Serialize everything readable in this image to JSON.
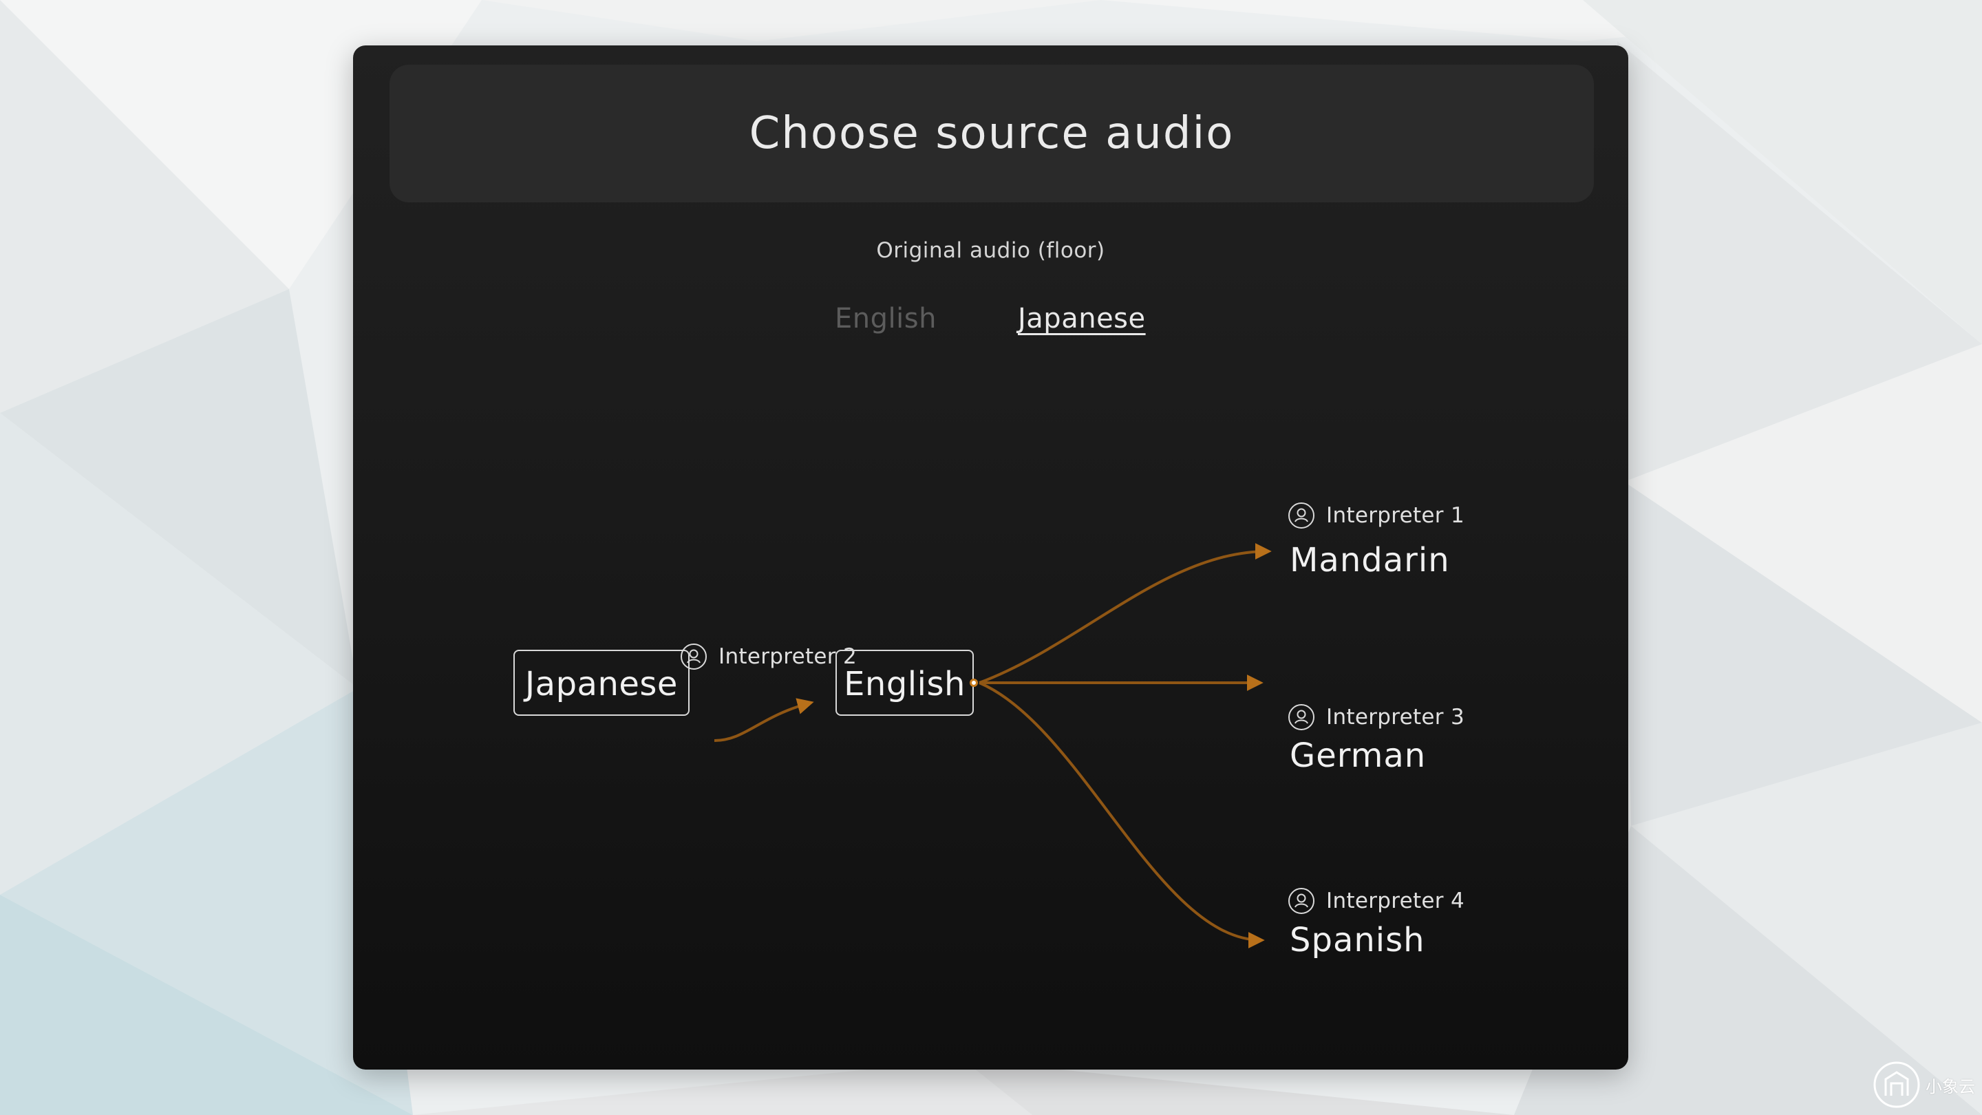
{
  "window": {
    "title": "Choose source audio"
  },
  "source": {
    "heading": "Original audio (floor)",
    "tabs": [
      {
        "label": "English",
        "active": false
      },
      {
        "label": "Japanese",
        "active": true
      }
    ]
  },
  "flow": {
    "source_node": "Japanese",
    "relay_node": "English",
    "relay_interpreter": "Interpreter 2",
    "targets": [
      {
        "interpreter": "Interpreter 1",
        "language": "Mandarin"
      },
      {
        "interpreter": "Interpreter 3",
        "language": "German"
      },
      {
        "interpreter": "Interpreter 4",
        "language": "Spanish"
      }
    ]
  },
  "brand": {
    "text": "小象云"
  },
  "colors": {
    "accent": "#c67a1c",
    "panel": "#1b1b1b",
    "header": "#2a2a2a"
  },
  "icons": {
    "interpreter": "person-circle-icon"
  }
}
